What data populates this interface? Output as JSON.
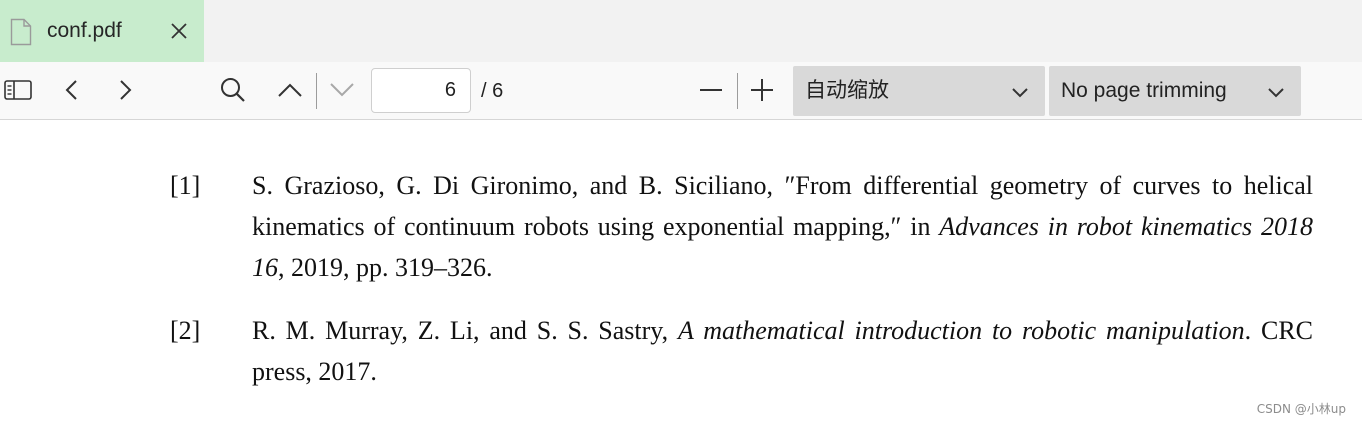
{
  "tab": {
    "title": "conf.pdf",
    "icon": "file-icon",
    "close_icon": "close-icon"
  },
  "toolbar": {
    "page_current": "6",
    "page_total": "/ 6",
    "zoom_select": "自动缩放",
    "trim_select": "No page trimming"
  },
  "references": [
    {
      "num": "[1]",
      "authors": "S. Grazioso, G. Di Gironimo, and B. Siciliano, ",
      "title": "″From differential geometry of curves to helical kinematics of continuum robots using exponential mapping,″",
      "in": " in ",
      "venue": "Advances in robot kinematics 2018 16",
      "tail": ", 2019, pp. 319–326."
    },
    {
      "num": "[2]",
      "authors": "R. M. Murray, Z. Li, and S. S. Sastry, ",
      "title": "A mathematical introduction to robotic manipulation",
      "tail": ". CRC press, 2017."
    }
  ],
  "watermark": "CSDN @小林up",
  "colors": {
    "tab_active": "#c8eccd",
    "toolbar_bg": "#f9f9f9",
    "dropdown_bg": "#d9d9d9"
  }
}
